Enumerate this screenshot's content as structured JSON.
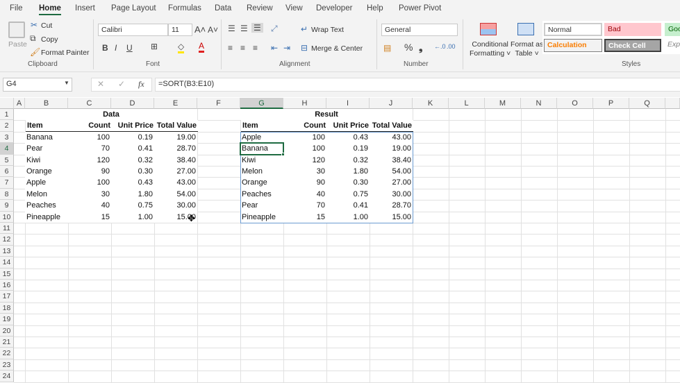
{
  "tabs": [
    "File",
    "Home",
    "Insert",
    "Page Layout",
    "Formulas",
    "Data",
    "Review",
    "View",
    "Developer",
    "Help",
    "Power Pivot"
  ],
  "active_tab": "Home",
  "clipboard": {
    "paste": "Paste",
    "cut": "Cut",
    "copy": "Copy",
    "format_painter": "Format Painter",
    "group": "Clipboard"
  },
  "font": {
    "name": "Calibri",
    "size": "11",
    "bold": "B",
    "italic": "I",
    "underline": "U",
    "group": "Font",
    "fill_color": "#ffe600",
    "font_color": "#e02020"
  },
  "alignment": {
    "wrap": "Wrap Text",
    "merge": "Merge & Center",
    "group": "Alignment"
  },
  "number": {
    "format": "General",
    "percent": "%",
    "comma": "❟",
    "group": "Number"
  },
  "styles": {
    "conditional": [
      "Conditional",
      "Formatting"
    ],
    "format_table": [
      "Format as",
      "Table"
    ],
    "normal": "Normal",
    "bad": "Bad",
    "good": "Goo",
    "calculation": "Calculation",
    "check_cell": "Check Cell",
    "explanatory": "Exp",
    "group": "Styles"
  },
  "formula_bar": {
    "name_box": "G4",
    "formula": "=SORT(B3:E10)"
  },
  "columns": [
    "A",
    "B",
    "C",
    "D",
    "E",
    "F",
    "G",
    "H",
    "I",
    "J",
    "K",
    "L",
    "M",
    "N",
    "O",
    "P",
    "Q"
  ],
  "rows": [
    "1",
    "2",
    "3",
    "4",
    "5",
    "6",
    "7",
    "8",
    "9",
    "10",
    "11",
    "12",
    "13",
    "14",
    "15",
    "16",
    "17",
    "18",
    "19",
    "20",
    "21",
    "22",
    "23",
    "24"
  ],
  "data_table": {
    "title": "Data",
    "headers": [
      "Item",
      "Count",
      "Unit Price",
      "Total Value"
    ],
    "rows": [
      [
        "Banana",
        "100",
        "0.19",
        "19.00"
      ],
      [
        "Pear",
        "70",
        "0.41",
        "28.70"
      ],
      [
        "Kiwi",
        "120",
        "0.32",
        "38.40"
      ],
      [
        "Orange",
        "90",
        "0.30",
        "27.00"
      ],
      [
        "Apple",
        "100",
        "0.43",
        "43.00"
      ],
      [
        "Melon",
        "30",
        "1.80",
        "54.00"
      ],
      [
        "Peaches",
        "40",
        "0.75",
        "30.00"
      ],
      [
        "Pineapple",
        "15",
        "1.00",
        "15.00"
      ]
    ]
  },
  "result_table": {
    "title": "Result",
    "headers": [
      "Item",
      "Count",
      "Unit Price",
      "Total Value"
    ],
    "rows": [
      [
        "Apple",
        "100",
        "0.43",
        "43.00"
      ],
      [
        "Banana",
        "100",
        "0.19",
        "19.00"
      ],
      [
        "Kiwi",
        "120",
        "0.32",
        "38.40"
      ],
      [
        "Melon",
        "30",
        "1.80",
        "54.00"
      ],
      [
        "Orange",
        "90",
        "0.30",
        "27.00"
      ],
      [
        "Peaches",
        "40",
        "0.75",
        "30.00"
      ],
      [
        "Pear",
        "70",
        "0.41",
        "28.70"
      ],
      [
        "Pineapple",
        "15",
        "1.00",
        "15.00"
      ]
    ]
  },
  "selected_cell": "G4"
}
